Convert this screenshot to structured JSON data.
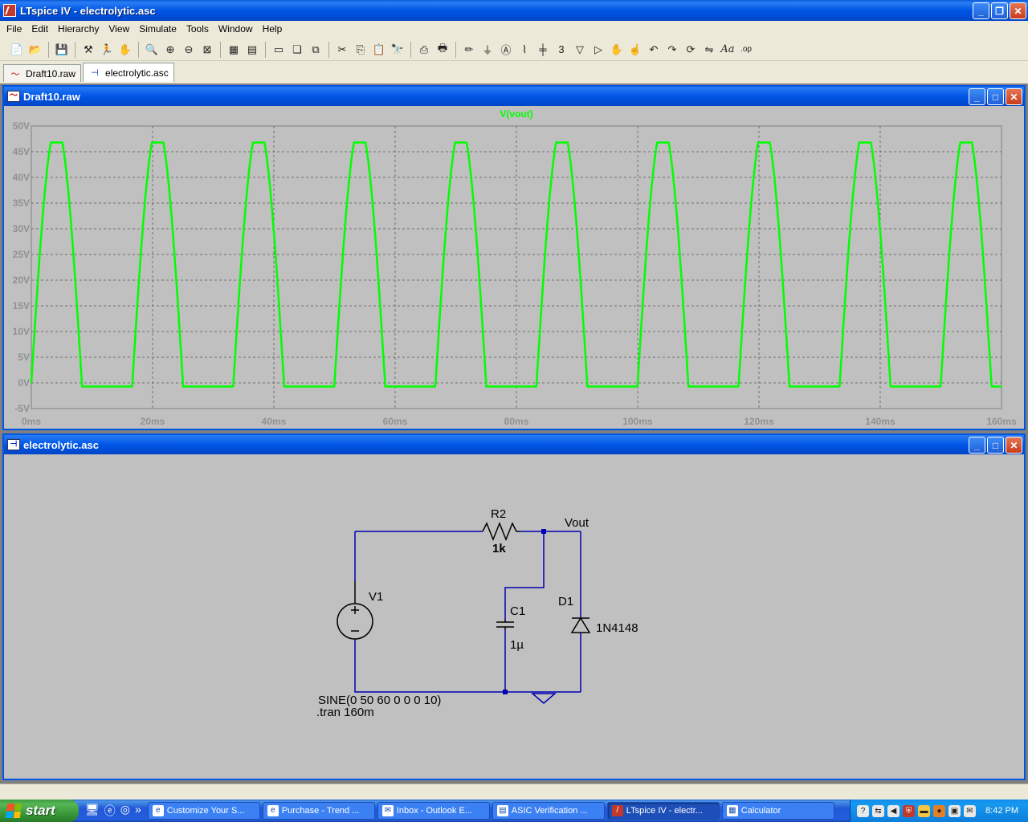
{
  "window": {
    "title": "LTspice IV - electrolytic.asc"
  },
  "menu": [
    "File",
    "Edit",
    "Hierarchy",
    "View",
    "Simulate",
    "Tools",
    "Window",
    "Help"
  ],
  "toolbar_icons": [
    "new-schematic-icon",
    "open-icon",
    "save-icon",
    "control-panel-icon",
    "run-icon",
    "halt-icon",
    "zoom-in-icon",
    "zoom-pan-icon",
    "zoom-out-icon",
    "zoom-fit-icon",
    "autorange-icon",
    "plot-settings-icon",
    "tile-horizontal-icon",
    "cascade-icon",
    "close-all-icon",
    "cut-icon",
    "copy-icon",
    "paste-icon",
    "find-icon",
    "print-setup-icon",
    "print-icon",
    "draw-wire-icon",
    "ground-icon",
    "label-net-icon",
    "resistor-icon",
    "capacitor-icon",
    "inductor-icon",
    "diode-icon",
    "component-icon",
    "move-icon",
    "drag-icon",
    "undo-icon",
    "redo-icon",
    "rotate-icon",
    "mirror-icon",
    "text-icon",
    "spice-directive-icon"
  ],
  "tabs": [
    {
      "label": "Draft10.raw",
      "icon": "waveform-icon",
      "active": false
    },
    {
      "label": "electrolytic.asc",
      "icon": "schematic-icon",
      "active": true
    }
  ],
  "wave_window": {
    "title": "Draft10.raw",
    "trace_label": "V(vout)",
    "trace_color": "#00ff00"
  },
  "chart_data": {
    "type": "line",
    "title": "V(vout)",
    "xlabel": "",
    "ylabel": "",
    "x_ticks": [
      "0ms",
      "20ms",
      "40ms",
      "60ms",
      "80ms",
      "100ms",
      "120ms",
      "140ms",
      "160ms"
    ],
    "y_ticks": [
      "50V",
      "45V",
      "40V",
      "35V",
      "30V",
      "25V",
      "20V",
      "15V",
      "10V",
      "5V",
      "0V",
      "-5V"
    ],
    "xlim_ms": [
      0,
      160
    ],
    "ylim_v": [
      -5,
      50
    ],
    "grid": true,
    "series": [
      {
        "name": "V(vout)",
        "color": "#00ff00",
        "description_params": {
          "frequency_hz": 60,
          "amplitude_v": 50,
          "clamp_low_v": -0.7,
          "peak_v": 46.8
        }
      }
    ]
  },
  "schematic_window": {
    "title": "electrolytic.asc",
    "labels": {
      "r2": "R2",
      "r2_value": "1k",
      "vout": "Vout",
      "v1": "V1",
      "c1": "C1",
      "c1_value": "1µ",
      "d1": "D1",
      "d1_value": "1N4148",
      "source": "SINE(0 50 60 0 0 0 10)",
      "directive": ".tran 160m"
    },
    "wire_color": "#0000b0"
  },
  "taskbar": {
    "start_label": "start",
    "buttons": [
      {
        "label": "Customize Your S...",
        "active": false
      },
      {
        "label": "Purchase - Trend ...",
        "active": false
      },
      {
        "label": "Inbox - Outlook E...",
        "active": false
      },
      {
        "label": "ASIC Verification ...",
        "active": false
      },
      {
        "label": "LTspice IV - electr...",
        "active": true
      },
      {
        "label": "Calculator",
        "active": false
      }
    ],
    "clock": "8:42 PM"
  }
}
